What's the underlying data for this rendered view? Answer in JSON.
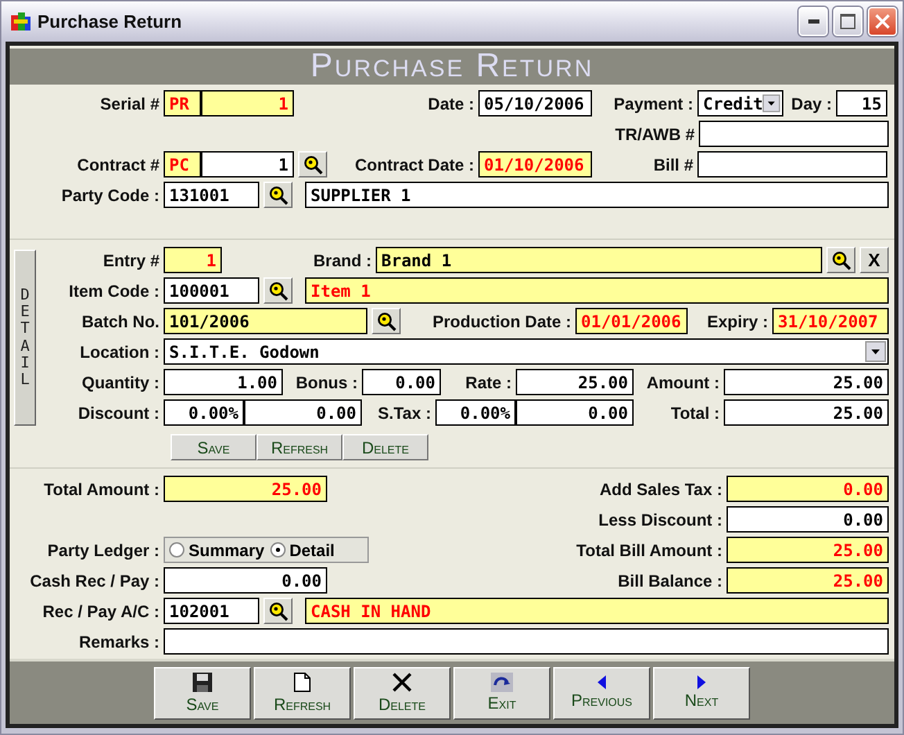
{
  "window": {
    "title": "Purchase Return"
  },
  "heading": "Purchase Return",
  "header": {
    "serial": {
      "label": "Serial #",
      "prefix": "PR",
      "value": "1"
    },
    "date": {
      "label": "Date :",
      "value": "05/10/2006"
    },
    "payment": {
      "label": "Payment :",
      "value": "Credit"
    },
    "day": {
      "label": "Day :",
      "value": "15"
    },
    "tr_awb": {
      "label": "TR/AWB #"
    },
    "contract": {
      "label": "Contract #",
      "prefix": "PC",
      "value": "1"
    },
    "contract_date": {
      "label": "Contract Date :",
      "value": "01/10/2006"
    },
    "bill": {
      "label": "Bill #"
    },
    "party_code": {
      "label": "Party Code :",
      "value": "131001",
      "name": "SUPPLIER 1"
    }
  },
  "detail": {
    "tab": "DETAIL",
    "entry": {
      "label": "Entry #",
      "value": "1"
    },
    "brand": {
      "label": "Brand :",
      "value": "Brand 1",
      "clear": "X"
    },
    "item_code": {
      "label": "Item Code :",
      "value": "100001",
      "name": "Item 1"
    },
    "batch": {
      "label": "Batch No.",
      "value": "101/2006"
    },
    "production_date": {
      "label": "Production Date :",
      "value": "01/01/2006"
    },
    "expiry": {
      "label": "Expiry :",
      "value": "31/10/2007"
    },
    "location": {
      "label": "Location :",
      "value": "S.I.T.E. Godown"
    },
    "quantity": {
      "label": "Quantity :",
      "value": "1.00"
    },
    "bonus": {
      "label": "Bonus :",
      "value": "0.00"
    },
    "rate": {
      "label": "Rate :",
      "value": "25.00"
    },
    "amount": {
      "label": "Amount :",
      "value": "25.00"
    },
    "discount": {
      "label": "Discount :",
      "percent": "0.00%",
      "value": "0.00"
    },
    "s_tax": {
      "label": "S.Tax :",
      "percent": "0.00%",
      "value": "0.00"
    },
    "total": {
      "label": "Total :",
      "value": "25.00"
    },
    "buttons": [
      "Save",
      "Refresh",
      "Delete"
    ]
  },
  "summary": {
    "total_amount": {
      "label": "Total Amount :",
      "value": "25.00"
    },
    "add_sales_tax": {
      "label": "Add Sales Tax :",
      "value": "0.00"
    },
    "less_discount": {
      "label": "Less Discount :",
      "value": "0.00"
    },
    "party_ledger": {
      "label": "Party Ledger :",
      "options": [
        {
          "label": "Summary",
          "selected": false
        },
        {
          "label": "Detail",
          "selected": true
        }
      ]
    },
    "total_bill_amount": {
      "label": "Total Bill Amount :",
      "value": "25.00"
    },
    "cash_rec_pay": {
      "label": "Cash Rec / Pay :",
      "value": "0.00"
    },
    "bill_balance": {
      "label": "Bill Balance :",
      "value": "25.00"
    },
    "rec_pay_ac": {
      "label": "Rec / Pay A/C :",
      "value": "102001",
      "name": "CASH IN HAND"
    },
    "remarks": {
      "label": "Remarks :"
    }
  },
  "toolbar": [
    {
      "kind": "save",
      "label": "Save"
    },
    {
      "kind": "refresh",
      "label": "Refresh"
    },
    {
      "kind": "delete",
      "label": "Delete"
    },
    {
      "kind": "exit",
      "label": "Exit"
    },
    {
      "kind": "previous",
      "label": "Previous"
    },
    {
      "kind": "next",
      "label": "Next"
    }
  ]
}
